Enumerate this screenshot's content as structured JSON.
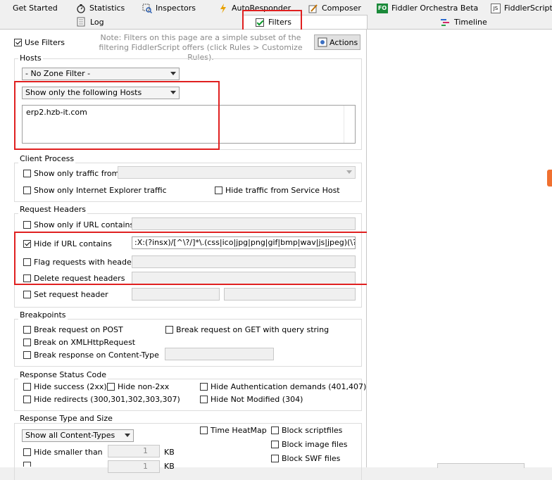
{
  "tabs_top": [
    {
      "label": "Get Started",
      "icon": "none"
    },
    {
      "label": "Statistics",
      "icon": "stopwatch-icon"
    },
    {
      "label": "Inspectors",
      "icon": "inspect-icon"
    },
    {
      "label": "AutoResponder",
      "icon": "lightning-icon"
    },
    {
      "label": "Composer",
      "icon": "pencil-icon"
    },
    {
      "label": "Fiddler Orchestra Beta",
      "icon": "fo-icon",
      "icon_text": "FO"
    },
    {
      "label": "FiddlerScript",
      "icon": "js-icon",
      "icon_text": "JS"
    }
  ],
  "tabs_second": [
    {
      "label": "Log",
      "icon": "log-icon"
    },
    {
      "label": "Filters",
      "icon": "checkbox-icon",
      "active": true
    },
    {
      "label": "Timeline",
      "icon": "timeline-icon"
    }
  ],
  "use_filters": {
    "label": "Use Filters",
    "checked": true
  },
  "note": "Note: Filters on this page are a simple subset of the filtering FiddlerScript offers (click Rules > Customize Rules).",
  "actions_label": "Actions",
  "hosts": {
    "title": "Hosts",
    "zone_filter": "- No Zone Filter -",
    "host_mode": "Show only the following Hosts",
    "host_list": "erp2.hzb-it.com"
  },
  "client_process": {
    "title": "Client Process",
    "show_traffic_from": "Show only traffic from",
    "show_ie": "Show only Internet Explorer traffic",
    "hide_service_host": "Hide traffic from Service Host"
  },
  "request_headers": {
    "title": "Request Headers",
    "show_if_url": "Show only if URL contains",
    "hide_if_url": "Hide if URL contains",
    "hide_if_url_value": ":X:(?insx)/[^\\?/]*\\.(css|ico|jpg|png|gif|bmp|wav|js|jpeg)(\\?.*)?$",
    "flag_with_headers": "Flag requests with headers",
    "delete_headers": "Delete request headers",
    "set_header": "Set request header"
  },
  "breakpoints": {
    "title": "Breakpoints",
    "break_post": "Break request on POST",
    "break_get": "Break request on GET with query string",
    "break_xhr": "Break on XMLHttpRequest",
    "break_content_type": "Break response on Content-Type"
  },
  "response_status": {
    "title": "Response Status Code",
    "hide_success": "Hide success (2xx)",
    "hide_non2xx": "Hide non-2xx",
    "hide_auth": "Hide Authentication demands (401,407)",
    "hide_redirects": "Hide redirects (300,301,302,303,307)",
    "hide_not_modified": "Hide Not Modified (304)"
  },
  "response_type": {
    "title": "Response Type and Size",
    "content_types": "Show all Content-Types",
    "time_heatmap": "Time HeatMap",
    "block_script": "Block scriptfiles",
    "block_image": "Block image files",
    "block_swf": "Block SWF files",
    "hide_smaller": "Hide smaller than",
    "hide_smaller_value": "1",
    "size_unit": "KB",
    "hide_larger_value": "1",
    "size_unit2": "KB"
  },
  "colors": {
    "highlight": "#e02020",
    "panel": "#ffffff",
    "chrome": "#f0f0f0"
  }
}
